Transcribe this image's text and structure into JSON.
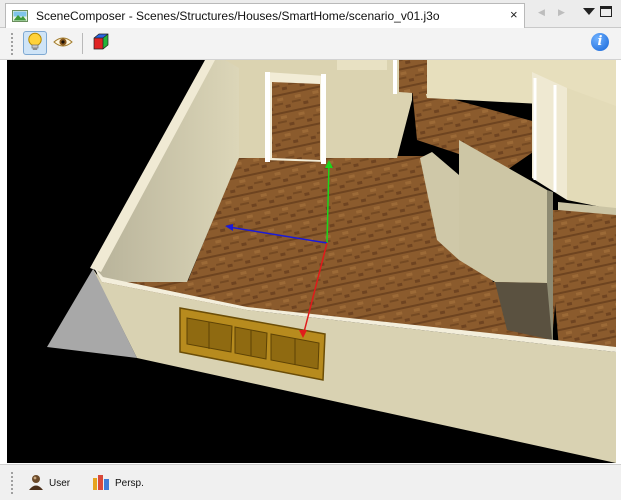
{
  "tab": {
    "title": "SceneComposer - Scenes/Structures/Houses/SmartHome/scenario_v01.j3o",
    "close_label": "×",
    "icon": "scene-image-icon"
  },
  "window_controls": {
    "prev_label": "◀",
    "next_label": "▶",
    "dropdown_icon": "chevron-down-icon",
    "maximize_icon": "maximize-icon"
  },
  "toolbar": {
    "buttons": [
      {
        "icon": "lightbulb-icon",
        "active": true
      },
      {
        "icon": "eye-icon",
        "active": false
      },
      {
        "icon": "cube-icon",
        "active": false
      }
    ],
    "info_label": "i"
  },
  "viewport": {
    "scene": "3D house floor plan with transform gizmo",
    "colors": {
      "background": "#000000",
      "x_axis": "#e01b1b",
      "y_axis": "#1bd61b",
      "z_axis": "#1b1bd8",
      "floor": "#8a5a2e",
      "wall": "#dcd6b8"
    }
  },
  "statusbar": {
    "camera_label": "User",
    "projection_label": "Persp."
  }
}
